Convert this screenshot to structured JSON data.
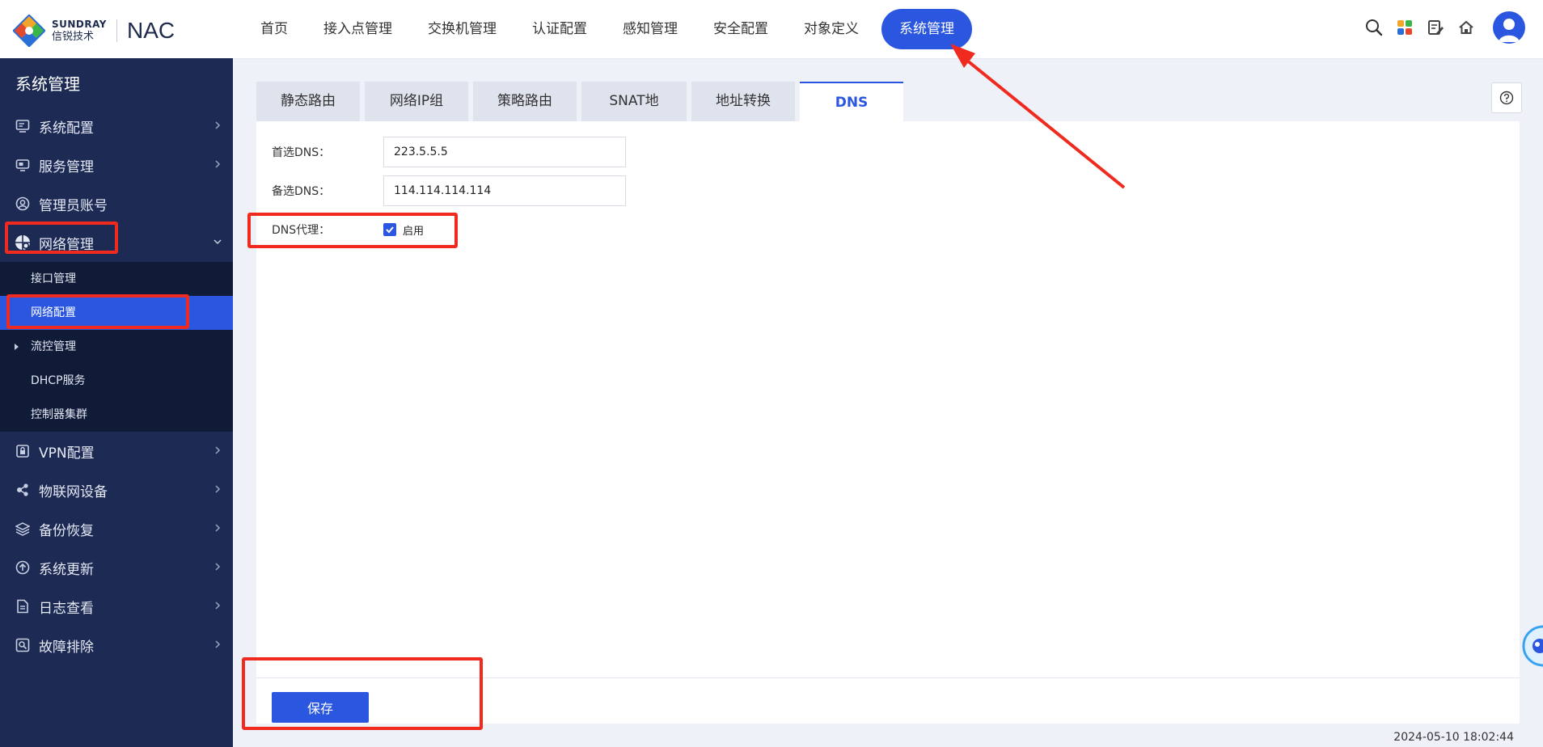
{
  "brand": {
    "logo_en": "SUNDRAY",
    "logo_cn": "信锐技术",
    "product": "NAC"
  },
  "topnav": [
    {
      "label": "首页"
    },
    {
      "label": "接入点管理"
    },
    {
      "label": "交换机管理"
    },
    {
      "label": "认证配置"
    },
    {
      "label": "感知管理"
    },
    {
      "label": "安全配置"
    },
    {
      "label": "对象定义"
    },
    {
      "label": "系统管理",
      "active": true
    }
  ],
  "top_icons": [
    "search-icon",
    "apps-icon",
    "edit-icon",
    "home-icon",
    "user-avatar"
  ],
  "sidebar": {
    "title": "系统管理",
    "items": [
      {
        "label": "系统配置",
        "icon": "monitor-icon"
      },
      {
        "label": "服务管理",
        "icon": "service-icon"
      },
      {
        "label": "管理员账号",
        "icon": "user-circle-icon"
      },
      {
        "label": "网络管理",
        "icon": "network-icon",
        "open": true
      },
      {
        "label": "VPN配置",
        "icon": "lock-icon"
      },
      {
        "label": "物联网设备",
        "icon": "iot-icon"
      },
      {
        "label": "备份恢复",
        "icon": "layers-icon"
      },
      {
        "label": "系统更新",
        "icon": "upload-icon"
      },
      {
        "label": "日志查看",
        "icon": "document-icon"
      },
      {
        "label": "故障排除",
        "icon": "troubleshoot-icon"
      }
    ],
    "submenu": [
      {
        "label": "接口管理"
      },
      {
        "label": "网络配置",
        "active": true
      },
      {
        "label": "流控管理",
        "expandable": true
      },
      {
        "label": "DHCP服务"
      },
      {
        "label": "控制器集群"
      }
    ]
  },
  "tabs": [
    {
      "label": "静态路由"
    },
    {
      "label": "网络IP组"
    },
    {
      "label": "策略路由"
    },
    {
      "label": "SNAT地址池"
    },
    {
      "label": "地址转换"
    },
    {
      "label": "DNS",
      "active": true
    }
  ],
  "form": {
    "primary_dns_label": "首选DNS：",
    "primary_dns_value": "223.5.5.5",
    "secondary_dns_label": "备选DNS：",
    "secondary_dns_value": "114.114.114.114",
    "dns_proxy_label": "DNS代理：",
    "dns_proxy_checkbox_label": "启用",
    "dns_proxy_enabled": true
  },
  "save_label": "保存",
  "timestamp": "2024-05-10 18:02:44",
  "colors": {
    "accent": "#2a56e0",
    "sidebar_bg": "#1c2a54",
    "submenu_bg": "#101b38",
    "annotation_red": "#f02a1e"
  }
}
